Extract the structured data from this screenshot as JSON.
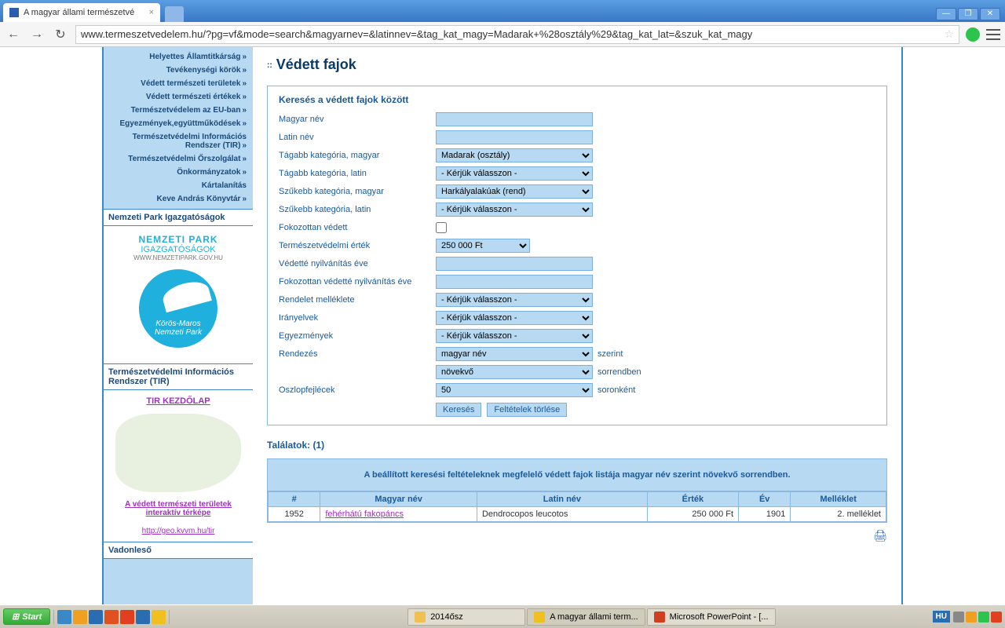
{
  "browser": {
    "tab_title": "A magyar állami természetvé",
    "url": "www.termeszetvedelem.hu/?pg=vf&mode=search&magyarnev=&latinnev=&tag_kat_magy=Madarak+%28osztály%29&tag_kat_lat=&szuk_kat_magy"
  },
  "sidebar": {
    "menu": [
      "Helyettes Államtitkárság",
      "Tevékenységi körök",
      "Védett természeti területek",
      "Védett természeti értékek",
      "Természetvédelem az EU-ban",
      "Egyezmények,együttműködések",
      "Természetvédelmi Információs Rendszer (TIR)",
      "Természetvédelmi Őrszolgálat",
      "Önkormányzatok",
      "Kártalanítás",
      "Keve András Könyvtár"
    ],
    "np_section": "Nemzeti Park Igazgatóságok",
    "np_title": "NEMZETI PARK",
    "np_sub": "IGAZGATÓSÁGOK",
    "np_url": "WWW.NEMZETIPARK.GOV.HU",
    "np_logo_top": "Körös-Maros",
    "np_logo_bottom": "Nemzeti Park",
    "tir_section": "Természetvédelmi Információs Rendszer (TIR)",
    "tir_link": "TIR KEZDŐLAP",
    "tir_text": "A védett természeti területek interaktív térképe",
    "tir_url": "http://geo.kvvm.hu/tir",
    "vadon": "Vadonleső"
  },
  "main": {
    "title": "Védett fajok",
    "form_title": "Keresés a védett fajok között",
    "labels": {
      "magyar_nev": "Magyar név",
      "latin_nev": "Latin név",
      "tag_magyar": "Tágabb kategória, magyar",
      "tag_latin": "Tágabb kategória, latin",
      "szuk_magyar": "Szűkebb kategória, magyar",
      "szuk_latin": "Szűkebb kategória, latin",
      "fokozott": "Fokozottan védett",
      "ertek": "Természetvédelmi érték",
      "vedette_ev": "Védetté nyilvánítás éve",
      "fokozott_ev": "Fokozottan védetté nyilvánítás éve",
      "melleklet": "Rendelet melléklete",
      "iranyelvek": "Irányelvek",
      "egyezmenyek": "Egyezmények",
      "rendezes": "Rendezés",
      "oszlop": "Oszlopfejlécek"
    },
    "values": {
      "tag_magyar": "Madarak (osztály)",
      "tag_latin": "- Kérjük válasszon -",
      "szuk_magyar": "Harkályalakúak (rend)",
      "szuk_latin": "- Kérjük válasszon -",
      "ertek": "250 000 Ft",
      "melleklet": "- Kérjük válasszon -",
      "iranyelvek": "- Kérjük válasszon -",
      "egyezmenyek": "- Kérjük válasszon -",
      "rendezes": "magyar név",
      "sorrend": "növekvő",
      "oszlop": "50"
    },
    "suffix": {
      "szerint": "szerint",
      "sorrendben": "sorrendben",
      "soronkent": "soronként"
    },
    "buttons": {
      "search": "Keresés",
      "clear": "Feltételek törlése"
    },
    "results_header": "Találatok: (1)",
    "results_msg": "A beállított keresési feltételeknek megfelelő védett fajok listája magyar név szerint növekvő sorrendben.",
    "table": {
      "headers": [
        "#",
        "Magyar név",
        "Latin név",
        "Érték",
        "Év",
        "Melléklet"
      ],
      "rows": [
        {
          "num": "1952",
          "magyar": "fehérhátú fakopáncs",
          "latin": "Dendrocopos leucotos",
          "ertek": "250 000 Ft",
          "ev": "1901",
          "mell": "2. melléklet"
        }
      ]
    }
  },
  "taskbar": {
    "start": "Start",
    "folder": "2014ősz",
    "chrome": "A magyar állami term...",
    "ppt": "Microsoft PowerPoint - [...",
    "lang": "HU"
  }
}
